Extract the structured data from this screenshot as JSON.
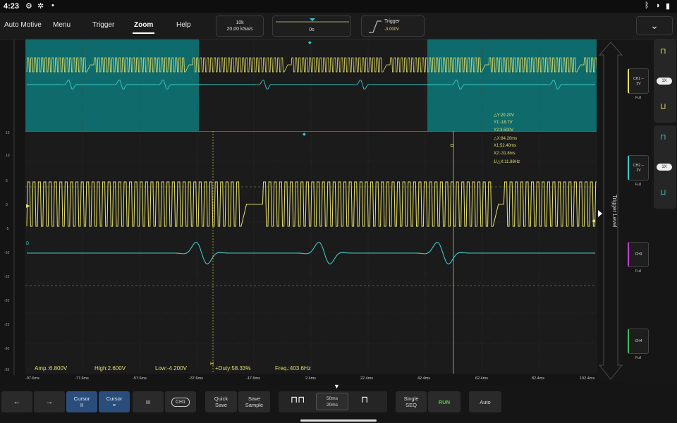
{
  "status_bar": {
    "time": "4:23"
  },
  "menu": {
    "items": [
      "Auto Motive",
      "Menu",
      "Trigger",
      "Zoom",
      "Help"
    ],
    "active": "Zoom"
  },
  "top_controls": {
    "rate_line1": "10k",
    "rate_line2": "20,00 kSa/s",
    "time_offset": "0s",
    "trigger_title": "Trigger",
    "trigger_value": "-3.000V"
  },
  "cursor_readout": {
    "dy": "△Y:20.20V",
    "y1": "Y1:-16.7V",
    "y2": "Y2:3.500V",
    "dx": "△X:84.20ms",
    "x1": "X1:52.40ms",
    "x2": "X2:-31.8ms",
    "inv_dx": "1/△X:11.88Hz"
  },
  "measurements": {
    "amp": "Amp.:6.800V",
    "high": "High:2.600V",
    "low": "Low:-4.200V",
    "duty": "+Duty:58.33%",
    "freq": "Freq.:403.6Hz"
  },
  "x_axis_ticks": [
    "-97.6ms",
    "-77.6ms",
    "-57.6ms",
    "-37.6ms",
    "-17.6ms",
    "2.4ms",
    "22.4ms",
    "42.4ms",
    "62.4ms",
    "82.4ms",
    "102.4ms"
  ],
  "right_rail": {
    "label": "Trigger Level"
  },
  "channels": [
    {
      "name": "CH1",
      "scale": "5V",
      "coupling": "Full",
      "color": "#e8e36a"
    },
    {
      "name": "CH2",
      "scale": "2V",
      "coupling": "Full",
      "color": "#3ec9c9"
    },
    {
      "name": "CH3",
      "scale": "",
      "coupling": "Full",
      "color": "#c43fd0"
    },
    {
      "name": "CH4",
      "scale": "",
      "coupling": "Full",
      "color": "#49b862"
    }
  ],
  "probe": {
    "ch1": "1X",
    "ch2": "1X"
  },
  "toolbar": {
    "prev": "←",
    "next": "→",
    "cursor_v": "Cursor\nII",
    "cursor_h": "Cursor\n=",
    "grid": "III",
    "ch_select": "CH1",
    "quick_save": "Quick\nSave",
    "save_sample": "Save\nSample",
    "timebase1": "50ms",
    "timebase2": "20ms",
    "single": "Single\nSEQ",
    "run": "RUN",
    "auto": "Auto"
  },
  "colors": {
    "ch1": "#e8e36a",
    "ch2": "#3ec9c9",
    "zoom_highlight": "#0f6b6b",
    "run_green": "#4ccf3b"
  }
}
